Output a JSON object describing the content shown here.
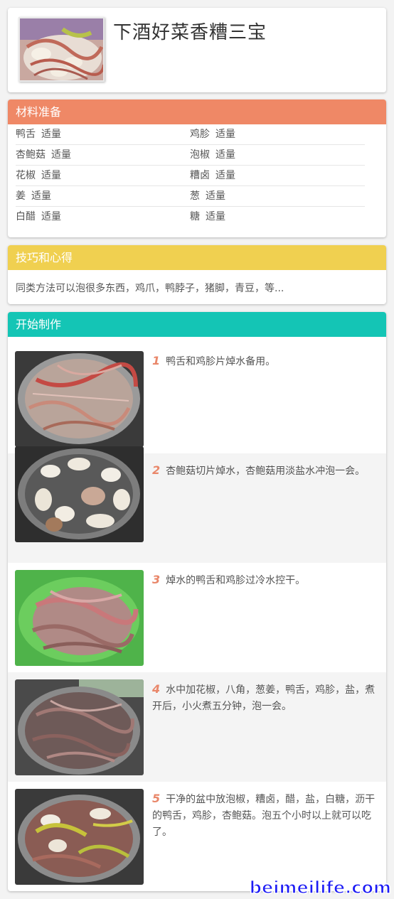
{
  "recipe": {
    "title": "下酒好菜香糟三宝"
  },
  "ingredients": {
    "heading": "材料准备",
    "color": "#ef8866",
    "items": [
      {
        "name": "鸭舌",
        "amount": "适量"
      },
      {
        "name": "鸡胗",
        "amount": "适量"
      },
      {
        "name": "杏鲍菇",
        "amount": "适量"
      },
      {
        "name": "泡椒",
        "amount": "适量"
      },
      {
        "name": "花椒",
        "amount": "适量"
      },
      {
        "name": "糟卤",
        "amount": "适量"
      },
      {
        "name": "姜",
        "amount": "适量"
      },
      {
        "name": "葱",
        "amount": "适量"
      },
      {
        "name": "白醋",
        "amount": "适量"
      },
      {
        "name": "糖",
        "amount": "适量"
      }
    ]
  },
  "tips": {
    "heading": "技巧和心得",
    "color": "#f0d050",
    "text": "同类方法可以泡很多东西，鸡爪，鸭脖子，猪脚，青豆，等..."
  },
  "steps": {
    "heading": "开始制作",
    "color": "#14c5b5",
    "items": [
      {
        "num": "1",
        "text": "鸭舌和鸡胗片焯水备用。"
      },
      {
        "num": "2",
        "text": "杏鲍菇切片焯水，杏鲍菇用淡盐水冲泡一会。"
      },
      {
        "num": "3",
        "text": "焯水的鸭舌和鸡胗过冷水控干。"
      },
      {
        "num": "4",
        "text": "水中加花椒，八角，葱姜，鸭舌，鸡胗，盐，煮开后，小火煮五分钟，泡一会。"
      },
      {
        "num": "5",
        "text": "干净的盆中放泡椒，糟卤，醋，盐，白糖，沥干的鸭舌，鸡胗，杏鲍菇。泡五个小时以上就可以吃了。"
      }
    ]
  },
  "watermark": "beimeilife.com"
}
